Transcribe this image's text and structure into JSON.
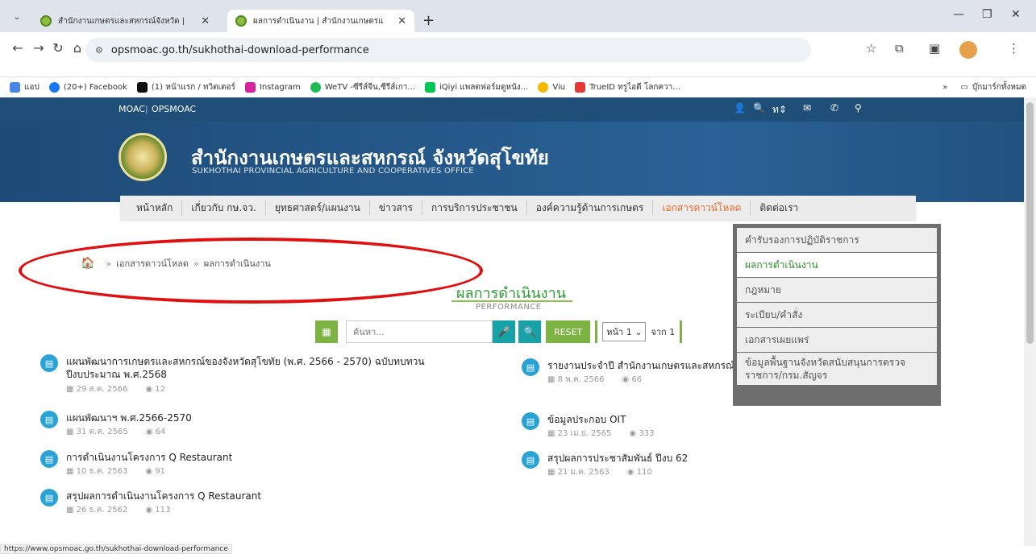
{
  "browser": {
    "tabs": [
      {
        "title": "สำนักงานเกษตรและสหกรณ์จังหวัด |"
      },
      {
        "title": "ผลการดำเนินงาน | สำนักงานเกษตรแ"
      }
    ],
    "url": "opsmoac.go.th/sukhothai-download-performance",
    "bookmarks": [
      {
        "label": "แอป",
        "color": "#4a86e8"
      },
      {
        "label": "(20+) Facebook",
        "color": "#1877f2"
      },
      {
        "label": "(1) หน้าแรก / ทวิตเตอร์",
        "color": "#111111"
      },
      {
        "label": "Instagram",
        "color": "#d6249f"
      },
      {
        "label": "WeTV -ซีรีส์จีน,ซีรีส์เกา...",
        "color": "#1db954"
      },
      {
        "label": "iQiyi แพลตฟอร์มดูหนัง...",
        "color": "#00c853"
      },
      {
        "label": "Viu",
        "color": "#f5b700"
      },
      {
        "label": "TrueID ทรูไอดี โลกควา...",
        "color": "#e53935"
      }
    ],
    "bookmarks_all": "บุ๊กมาร์กทั้งหมด",
    "status_url": "https://www.opsmoac.go.th/sukhothai-download-performance"
  },
  "site": {
    "top_links": [
      "MOAC",
      "OPSMOAC"
    ],
    "lang": "ท",
    "title": "สำนักงานเกษตรและสหกรณ์ จังหวัดสุโขทัย",
    "subtitle": "SUKHOTHAI PROVINCIAL AGRICULTURE AND COOPERATIVES OFFICE"
  },
  "nav": [
    "หน้าหลัก",
    "เกี่ยวกับ กษ.จว.",
    "ยุทธศาสตร์/แผนงาน",
    "ข่าวสาร",
    "การบริการประชาชน",
    "องค์ความรู้ด้านการเกษตร",
    "เอกสารดาวน์โหลด",
    "ติดต่อเรา"
  ],
  "dropdown": [
    "คำรับรองการปฏิบัติราชการ",
    "ผลการดำเนินงาน",
    "กฎหมาย",
    "ระเบียบ/คำสั่ง",
    "เอกสารเผยแพร่",
    "ข้อมูลพื้นฐานจังหวัดสนับสนุนการตรวจราชการ/กรม.สัญจร"
  ],
  "breadcrumb": [
    "เอกสารดาวน์โหลด",
    "ผลการดำเนินงาน"
  ],
  "page": {
    "title": "ผลการดำเนินงาน",
    "subtitle": "PERFORMANCE"
  },
  "filter": {
    "search_placeholder": "ค้นหา...",
    "reset": "RESET",
    "page_label": "หน้า 1",
    "page_of": "จาก 1"
  },
  "items_left": [
    {
      "title": "แผนพัฒนาการเกษตรและสหกรณ์ของจังหวัดสุโขทัย (พ.ศ. 2566 - 2570) ฉบับทบทวน",
      "title2": "ปีงบประมาณ พ.ศ.2568",
      "date": "29 ส.ค. 2566",
      "views": "12"
    },
    {
      "title": "แผนพัฒนาฯ พ.ศ.2566-2570",
      "date": "31 ต.ค. 2565",
      "views": "64"
    },
    {
      "title": "การดำเนินงานโครงการ Q Restaurant",
      "date": "10 ธ.ค. 2563",
      "views": "91"
    },
    {
      "title": "สรุปผลการดำเนินงานโครงการ Q Restaurant",
      "date": "26 ธ.ค. 2562",
      "views": "113"
    }
  ],
  "items_right": [
    {
      "title": "รายงานประจำปี สำนักงานเกษตรและสหกรณ์จังหวัดสุโขทัย",
      "date": "8 พ.ค. 2566",
      "views": "66"
    },
    {
      "title": "ข้อมูลประกอบ OIT",
      "date": "23 เม.ย. 2565",
      "views": "333"
    },
    {
      "title": "สรุปผลการประชาสัมพันธ์ ปีงบ 62",
      "date": "21 ม.ค. 2563",
      "views": "110"
    }
  ]
}
